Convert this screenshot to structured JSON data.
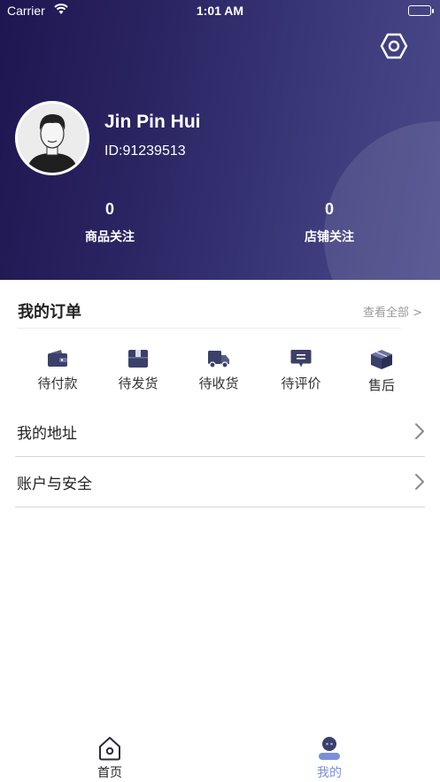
{
  "status_bar": {
    "carrier": "Carrier",
    "time": "1:01 AM"
  },
  "profile": {
    "name": "Jin Pin Hui",
    "id_text": "ID:91239513"
  },
  "stats": [
    {
      "value": "0",
      "label": "商品关注"
    },
    {
      "value": "0",
      "label": "店铺关注"
    }
  ],
  "orders": {
    "title": "我的订单",
    "view_all": "查看全部 >",
    "items": [
      {
        "label": "待付款",
        "icon": "wallet-icon"
      },
      {
        "label": "待发货",
        "icon": "package-box-icon"
      },
      {
        "label": "待收货",
        "icon": "delivery-truck-icon"
      },
      {
        "label": "待评价",
        "icon": "review-comment-icon"
      },
      {
        "label": "售后",
        "icon": "cube-box-icon"
      }
    ]
  },
  "menu": [
    {
      "label": "我的地址"
    },
    {
      "label": "账户与安全"
    }
  ],
  "tabbar": {
    "items": [
      {
        "label": "首页",
        "icon": "home-icon"
      },
      {
        "label": "我的",
        "icon": "profile-icon",
        "active": true
      }
    ]
  },
  "colors": {
    "header_gradient_start": "#1e1650",
    "header_gradient_end": "#4a4a8a",
    "icon_dark": "#3b4068",
    "tab_active": "#7b8fd8"
  }
}
